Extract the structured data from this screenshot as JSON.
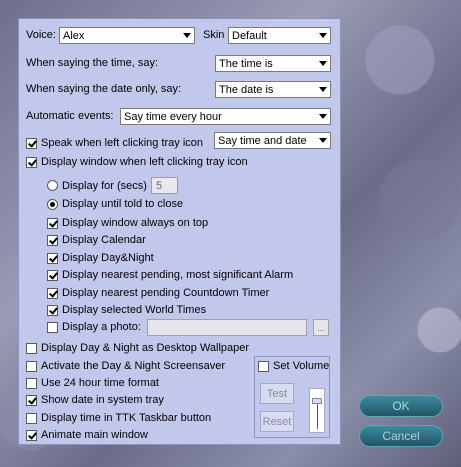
{
  "voice": {
    "label": "Voice:",
    "value": "Alex"
  },
  "skin": {
    "label": "Skin",
    "value": "Default"
  },
  "time_say": {
    "label": "When saying the time, say:",
    "value": "The time is"
  },
  "date_say": {
    "label": "When saying the date only, say:",
    "value": "The date is"
  },
  "auto_events": {
    "label": "Automatic events:",
    "value": "Say time every hour"
  },
  "speak_click": {
    "label": "Speak when left clicking tray icon",
    "checked": true,
    "value": "Say time and date"
  },
  "display_window": {
    "label": "Display window  when left clicking tray icon",
    "checked": true
  },
  "display_for": {
    "label": "Display for (secs)",
    "value": "5",
    "selected": false
  },
  "display_until": {
    "label": "Display until told to close",
    "selected": true
  },
  "options": [
    {
      "label": "Display window always on top",
      "checked": true
    },
    {
      "label": "Display Calendar",
      "checked": true
    },
    {
      "label": "Display Day&Night",
      "checked": true
    },
    {
      "label": "Display nearest pending, most significant Alarm",
      "checked": true
    },
    {
      "label": "Display nearest pending Countdown Timer",
      "checked": true
    },
    {
      "label": "Display selected World Times",
      "checked": true
    },
    {
      "label": "Display a photo:",
      "checked": false
    }
  ],
  "photo": {
    "dots": "..."
  },
  "bottom": [
    {
      "label": "Display Day & Night as Desktop Wallpaper",
      "checked": false
    },
    {
      "label": "Activate the Day & Night Screensaver",
      "checked": false
    },
    {
      "label": "Use 24 hour time format",
      "checked": false
    },
    {
      "label": "Show date in system tray",
      "checked": true
    },
    {
      "label": "Display time in TTK Taskbar button",
      "checked": false
    },
    {
      "label": "Animate main window",
      "checked": true
    }
  ],
  "volume": {
    "label": "Set Volume",
    "checked": false,
    "test": "Test",
    "reset": "Reset",
    "level": 0.85
  },
  "buttons": {
    "ok": "OK",
    "cancel": "Cancel"
  }
}
